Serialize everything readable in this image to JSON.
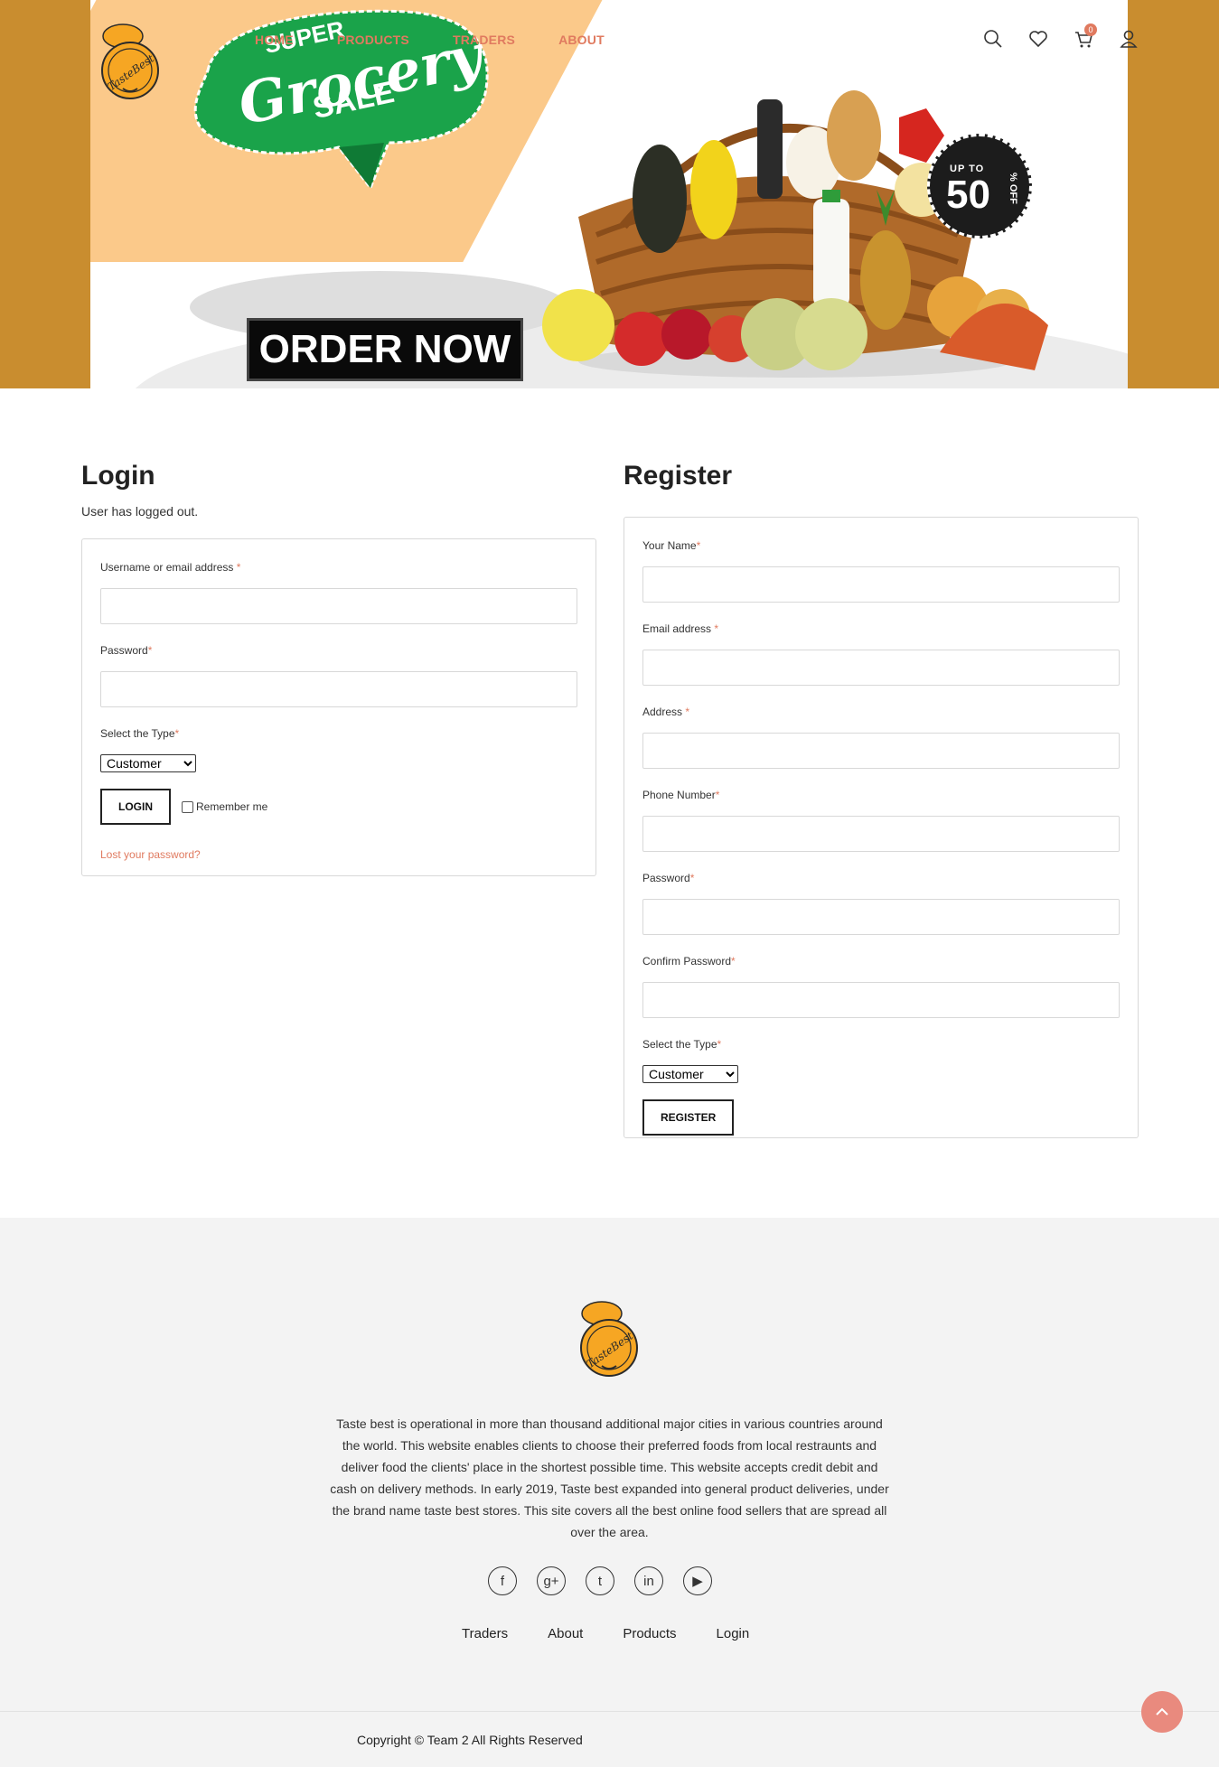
{
  "brand": {
    "logo_text": "TasteBest"
  },
  "nav": {
    "items": [
      {
        "label": "HOME"
      },
      {
        "label": "PRODUCTS"
      },
      {
        "label": "TRADERS"
      },
      {
        "label": "ABOUT"
      }
    ],
    "icons": [
      "search-icon",
      "heart-icon",
      "cart-icon",
      "user-icon"
    ],
    "cart_count": "0"
  },
  "hero": {
    "line1": "SUPER",
    "line2": "Grocery",
    "line3": "SALE",
    "discount_prefix": "UP TO",
    "discount_value": "50",
    "discount_suffix": "% OFF",
    "cta": "ORDER NOW"
  },
  "login": {
    "title": "Login",
    "message": "User has logged out.",
    "username_label": "Username or email address",
    "password_label": "Password",
    "type_label": "Select the Type",
    "type_selected": "Customer",
    "submit": "LOGIN",
    "remember": "Remember me",
    "lost_password": "Lost your password?"
  },
  "register": {
    "title": "Register",
    "name_label": "Your Name",
    "email_label": "Email address",
    "address_label": "Address",
    "phone_label": "Phone Number",
    "password_label": "Password",
    "confirm_label": "Confirm Password",
    "type_label": "Select the Type",
    "type_selected": "Customer",
    "submit": "REGISTER"
  },
  "required_mark": "*",
  "footer": {
    "about": "Taste best is operational in more than thousand additional major cities in various countries around the world. This website enables clients to choose their preferred foods from local restraunts and deliver food the clients' place in the shortest possible time. This website accepts credit debit and cash on delivery methods. In early 2019, Taste best expanded into general product deliveries, under the brand name taste best stores. This site covers all the best online food sellers that are spread all over the area.",
    "social": [
      {
        "glyph": "f",
        "name": "facebook-icon"
      },
      {
        "glyph": "g+",
        "name": "google-plus-icon"
      },
      {
        "glyph": "t",
        "name": "tumblr-icon"
      },
      {
        "glyph": "in",
        "name": "linkedin-icon"
      },
      {
        "glyph": "▶",
        "name": "youtube-icon"
      }
    ],
    "links": [
      "Traders",
      "About",
      "Products",
      "Login"
    ],
    "copyright": "Copyright © Team 2 All Rights Reserved"
  },
  "colors": {
    "accent": "#e07a5f",
    "hero_frame": "#c98d2f",
    "hero_peach": "#fbc98a",
    "ribbon_green": "#1aa34a",
    "footer_bg": "#f3f3f3",
    "to_top": "#e98a7e"
  }
}
